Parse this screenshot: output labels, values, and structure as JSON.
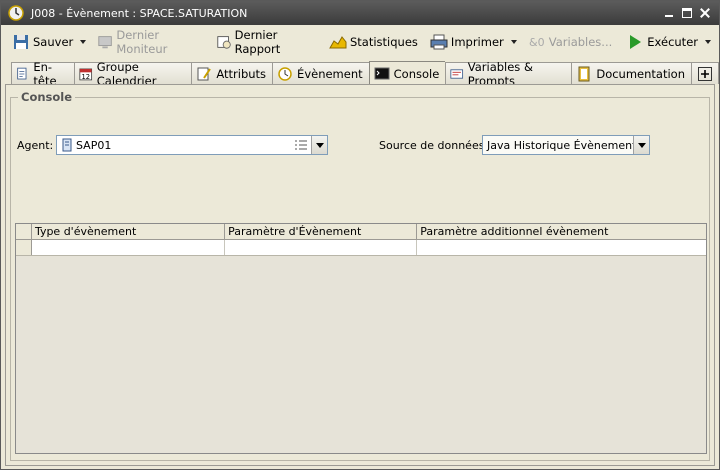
{
  "window": {
    "title": "J008 - Évènement : SPACE.SATURATION"
  },
  "toolbar": {
    "save": "Sauver",
    "last_monitor": "Dernier Moniteur",
    "last_report": "Dernier Rapport",
    "statistics": "Statistiques",
    "print": "Imprimer",
    "variables": "Variables...",
    "execute": "Exécuter"
  },
  "tabs": [
    {
      "label": "En-tête"
    },
    {
      "label": "Groupe Calendrier"
    },
    {
      "label": "Attributs"
    },
    {
      "label": "Évènement"
    },
    {
      "label": "Console"
    },
    {
      "label": "Variables & Prompts"
    },
    {
      "label": "Documentation"
    }
  ],
  "console": {
    "group_title": "Console",
    "agent_label": "Agent:",
    "agent_value": "SAP01",
    "source_label": "Source de données:",
    "source_value": "Java Historique Évènement"
  },
  "table": {
    "columns": [
      "Type d'évènement",
      "Paramètre d'Évènement",
      "Paramètre additionnel évènement"
    ]
  },
  "colors": {
    "title_bar": "#4a4a4a",
    "active_tab": "#ece9d8",
    "accent_green": "#2a9a2a"
  }
}
